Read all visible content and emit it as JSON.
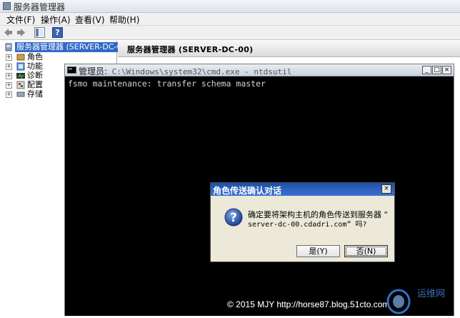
{
  "window": {
    "title": "服务器管理器"
  },
  "menu": [
    "文件(F)",
    "操作(A)",
    "查看(V)",
    "帮助(H)"
  ],
  "tree": {
    "root": "服务器管理器 (SERVER-DC-00)",
    "items": [
      "角色",
      "功能",
      "诊断",
      "配置",
      "存储"
    ]
  },
  "right_pane": {
    "header": "服务器管理器 (SERVER-DC-00)"
  },
  "cmd": {
    "title_prefix": "管理员:",
    "title_path": " C:\\Windows\\system32\\cmd.exe - ntdsutil",
    "output": "fsmo maintenance: transfer schema master"
  },
  "dialog": {
    "title": "角色传送确认对话",
    "message_line1": "确定要将架构主机的角色传送到服务器 “",
    "message_line2": "server-dc-00.cdadri.com” 吗?",
    "yes": "是(Y)",
    "no": "否(N)"
  },
  "watermark": {
    "copyright": "© 2015 MJY http://horse87.blog.51cto.com",
    "logo_text": "运维网"
  },
  "colors": {
    "selection": "#3169c6",
    "dialog_title": "#1f50a8",
    "console_bg": "#000000",
    "console_text": "#d6d6d6"
  }
}
